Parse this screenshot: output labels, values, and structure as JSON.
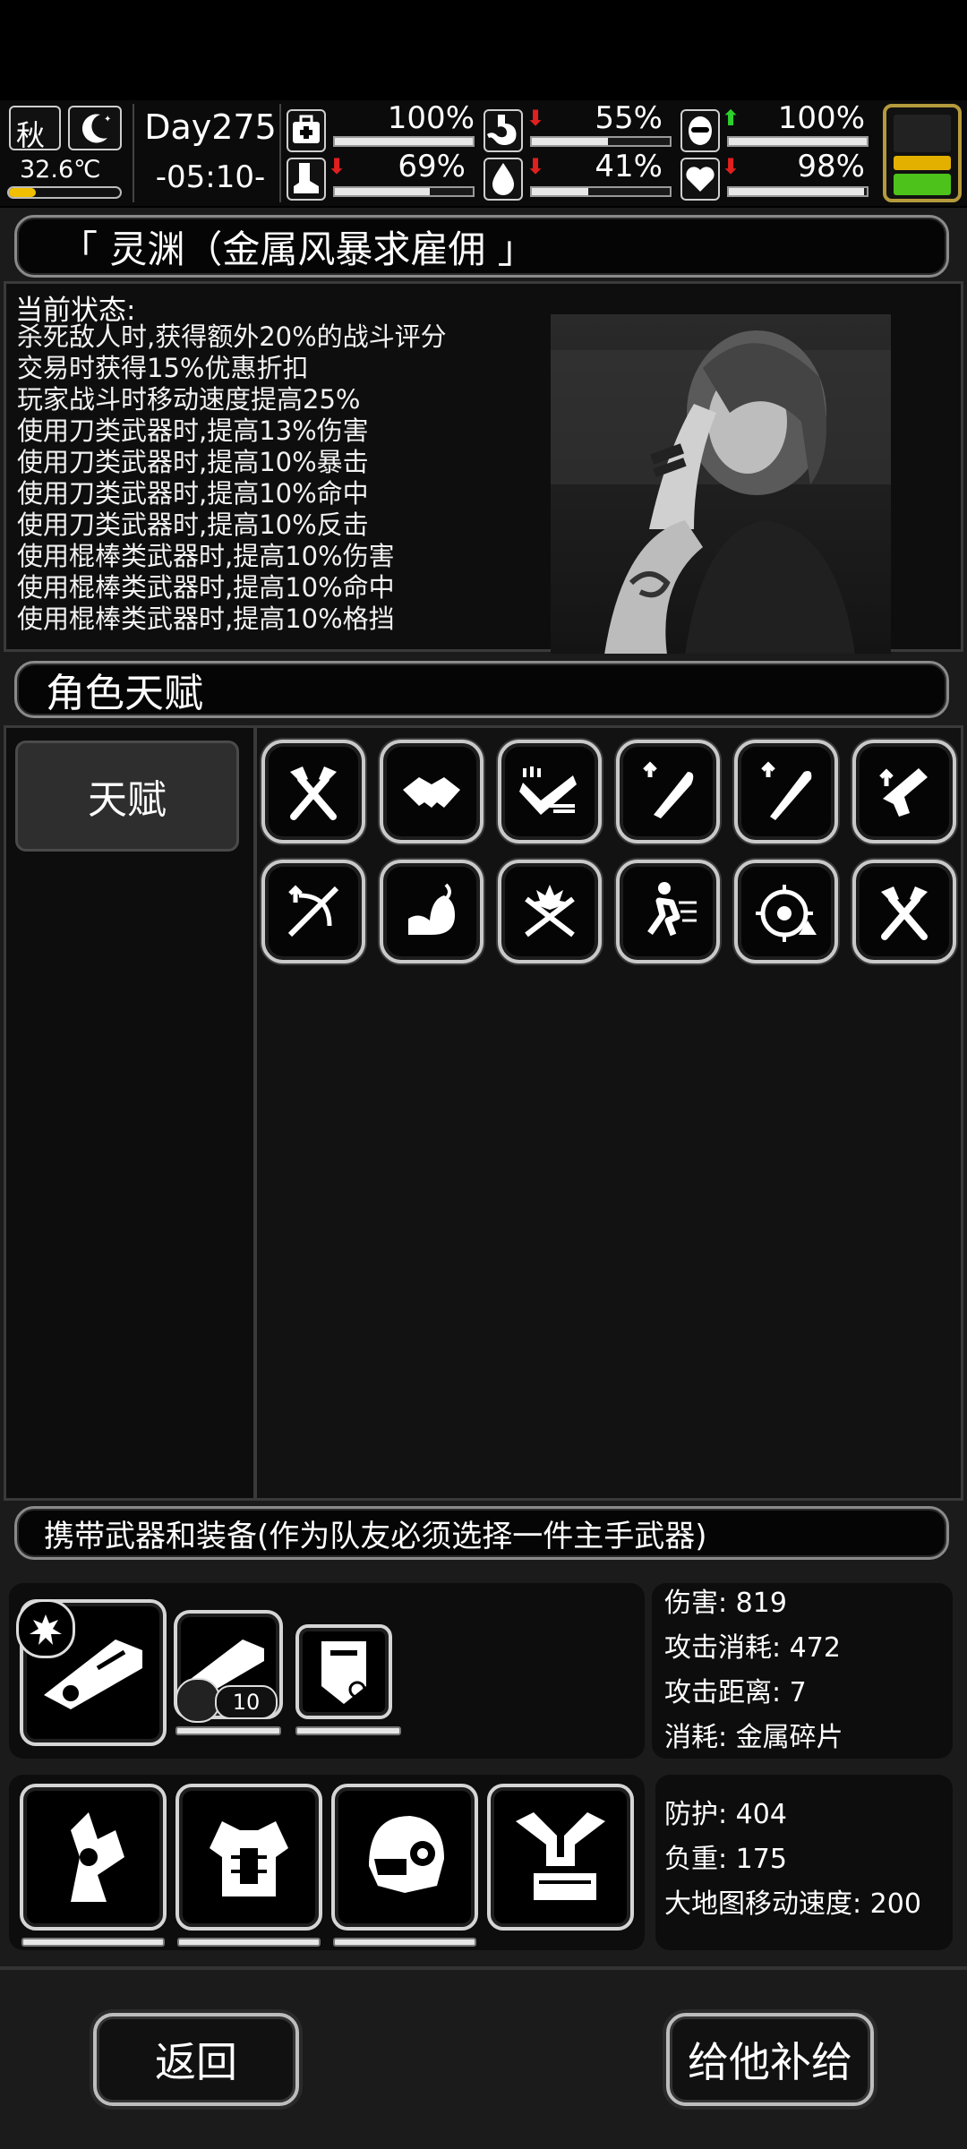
{
  "hud": {
    "season": "秋",
    "temperature": "32.6℃",
    "day": "Day275",
    "time": "-05:10-",
    "stats": [
      {
        "icon": "medkit-icon",
        "value": "100%",
        "fill": 1.0,
        "trend": ""
      },
      {
        "icon": "stomach-icon",
        "value": "55%",
        "fill": 0.55,
        "trend": "down"
      },
      {
        "icon": "mask-icon",
        "value": "100%",
        "fill": 1.0,
        "trend": "up"
      },
      {
        "icon": "boot-icon",
        "value": "69%",
        "fill": 0.69,
        "trend": "down"
      },
      {
        "icon": "water-drop-icon",
        "value": "41%",
        "fill": 0.41,
        "trend": "down"
      },
      {
        "icon": "heart-icon",
        "value": "98%",
        "fill": 0.98,
        "trend": "down"
      }
    ]
  },
  "character": {
    "name": "「 灵渊（金属风暴求雇佣 」",
    "status_title": "当前状态:",
    "status_lines": [
      "杀死敌人时,获得额外20%的战斗评分",
      "交易时获得15%优惠折扣",
      "玩家战斗时移动速度提高25%",
      "使用刀类武器时,提高13%伤害",
      "使用刀类武器时,提高10%暴击",
      "使用刀类武器时,提高10%命中",
      "使用刀类武器时,提高10%反击",
      "使用棍棒类武器时,提高10%伤害",
      "使用棍棒类武器时,提高10%命中",
      "使用棍棒类武器时,提高10%格挡"
    ]
  },
  "talents": {
    "section_title": "角色天赋",
    "tab_label": "天赋",
    "icons": [
      "crossed-axes-icon",
      "handshake-icon",
      "dash-strike-icon",
      "machete-up-icon",
      "bat-up-icon",
      "gun-up-icon",
      "crossbow-up-icon",
      "flexed-arm-icon",
      "crossed-blades-burst-icon",
      "running-man-icon",
      "target-up-icon",
      "crossed-axes-icon"
    ]
  },
  "equipment": {
    "section_title": "携带武器和装备(作为队友必须选择一件主手武器)",
    "ammo_count": "10",
    "weapon_stats": [
      "伤害: 819",
      "攻击消耗: 472",
      "攻击距离: 7",
      "消耗: 金属碎片"
    ],
    "armor_stats": [
      "防护: 404",
      "负重: 175",
      "大地图移动速度: 200"
    ]
  },
  "buttons": {
    "back": "返回",
    "supply": "给他补给"
  }
}
